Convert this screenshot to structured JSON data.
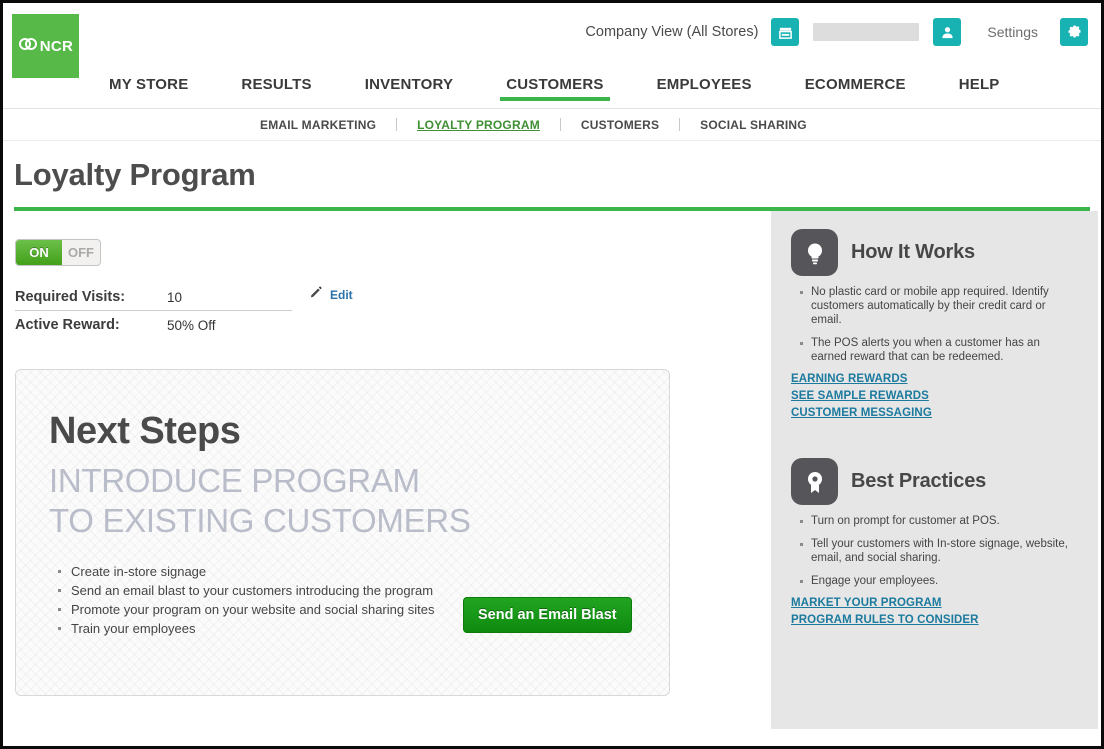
{
  "header": {
    "logo_text": "NCR",
    "logo_icon": "ncr-interlocking-circles-logo",
    "company_view": "Company View (All Stores)",
    "store_icon": "store-icon",
    "user_name_redacted": "",
    "user_icon": "person-icon",
    "settings_label": "Settings",
    "gear_icon": "gear-icon"
  },
  "mainnav": {
    "items": [
      {
        "label": "MY STORE",
        "active": false
      },
      {
        "label": "RESULTS",
        "active": false
      },
      {
        "label": "INVENTORY",
        "active": false
      },
      {
        "label": "CUSTOMERS",
        "active": true
      },
      {
        "label": "EMPLOYEES",
        "active": false
      },
      {
        "label": "ECOMMERCE",
        "active": false
      },
      {
        "label": "HELP",
        "active": false
      }
    ]
  },
  "subnav": {
    "items": [
      {
        "label": "EMAIL MARKETING",
        "active": false
      },
      {
        "label": "LOYALTY PROGRAM",
        "active": true
      },
      {
        "label": "CUSTOMERS",
        "active": false
      },
      {
        "label": "SOCIAL SHARING",
        "active": false
      }
    ]
  },
  "page": {
    "title": "Loyalty Program"
  },
  "controls": {
    "toggle_on_label": "ON",
    "toggle_off_label": "OFF",
    "toggle_state": "ON",
    "required_visits_label": "Required Visits:",
    "required_visits_value": "10",
    "active_reward_label": "Active Reward:",
    "active_reward_value": "50% Off",
    "edit_label": "Edit",
    "edit_icon": "pencil-icon"
  },
  "next_steps": {
    "title": "Next Steps",
    "subtitle_line1": "INTRODUCE PROGRAM",
    "subtitle_line2": "TO EXISTING CUSTOMERS",
    "bullets": [
      "Create in-store signage",
      "Send an email blast to your customers introducing the program",
      "Promote your program on your website and social sharing sites",
      "Train your employees"
    ],
    "cta_label": "Send an Email Blast"
  },
  "sidebar": {
    "how_it_works": {
      "icon": "lightbulb-icon",
      "title": "How It Works",
      "bullets": [
        "No plastic card or mobile app required. Identify customers automatically by their credit card or email.",
        "The POS alerts you when a customer has an earned reward that can be redeemed."
      ],
      "links": [
        "EARNING REWARDS",
        "SEE SAMPLE REWARDS",
        "CUSTOMER MESSAGING"
      ]
    },
    "best_practices": {
      "icon": "award-badge-icon",
      "title": "Best Practices",
      "bullets": [
        "Turn on prompt for customer at POS.",
        "Tell your customers with In-store signage, website, email, and social sharing.",
        "Engage your employees."
      ],
      "links": [
        "MARKET YOUR PROGRAM",
        "PROGRAM RULES TO CONSIDER"
      ]
    }
  },
  "colors": {
    "brand_green": "#56b948",
    "accent_green": "#3cb54a",
    "teal": "#18b2b2",
    "link_blue": "#1b7a9e",
    "sidebar_gray": "#e6e6e6"
  }
}
